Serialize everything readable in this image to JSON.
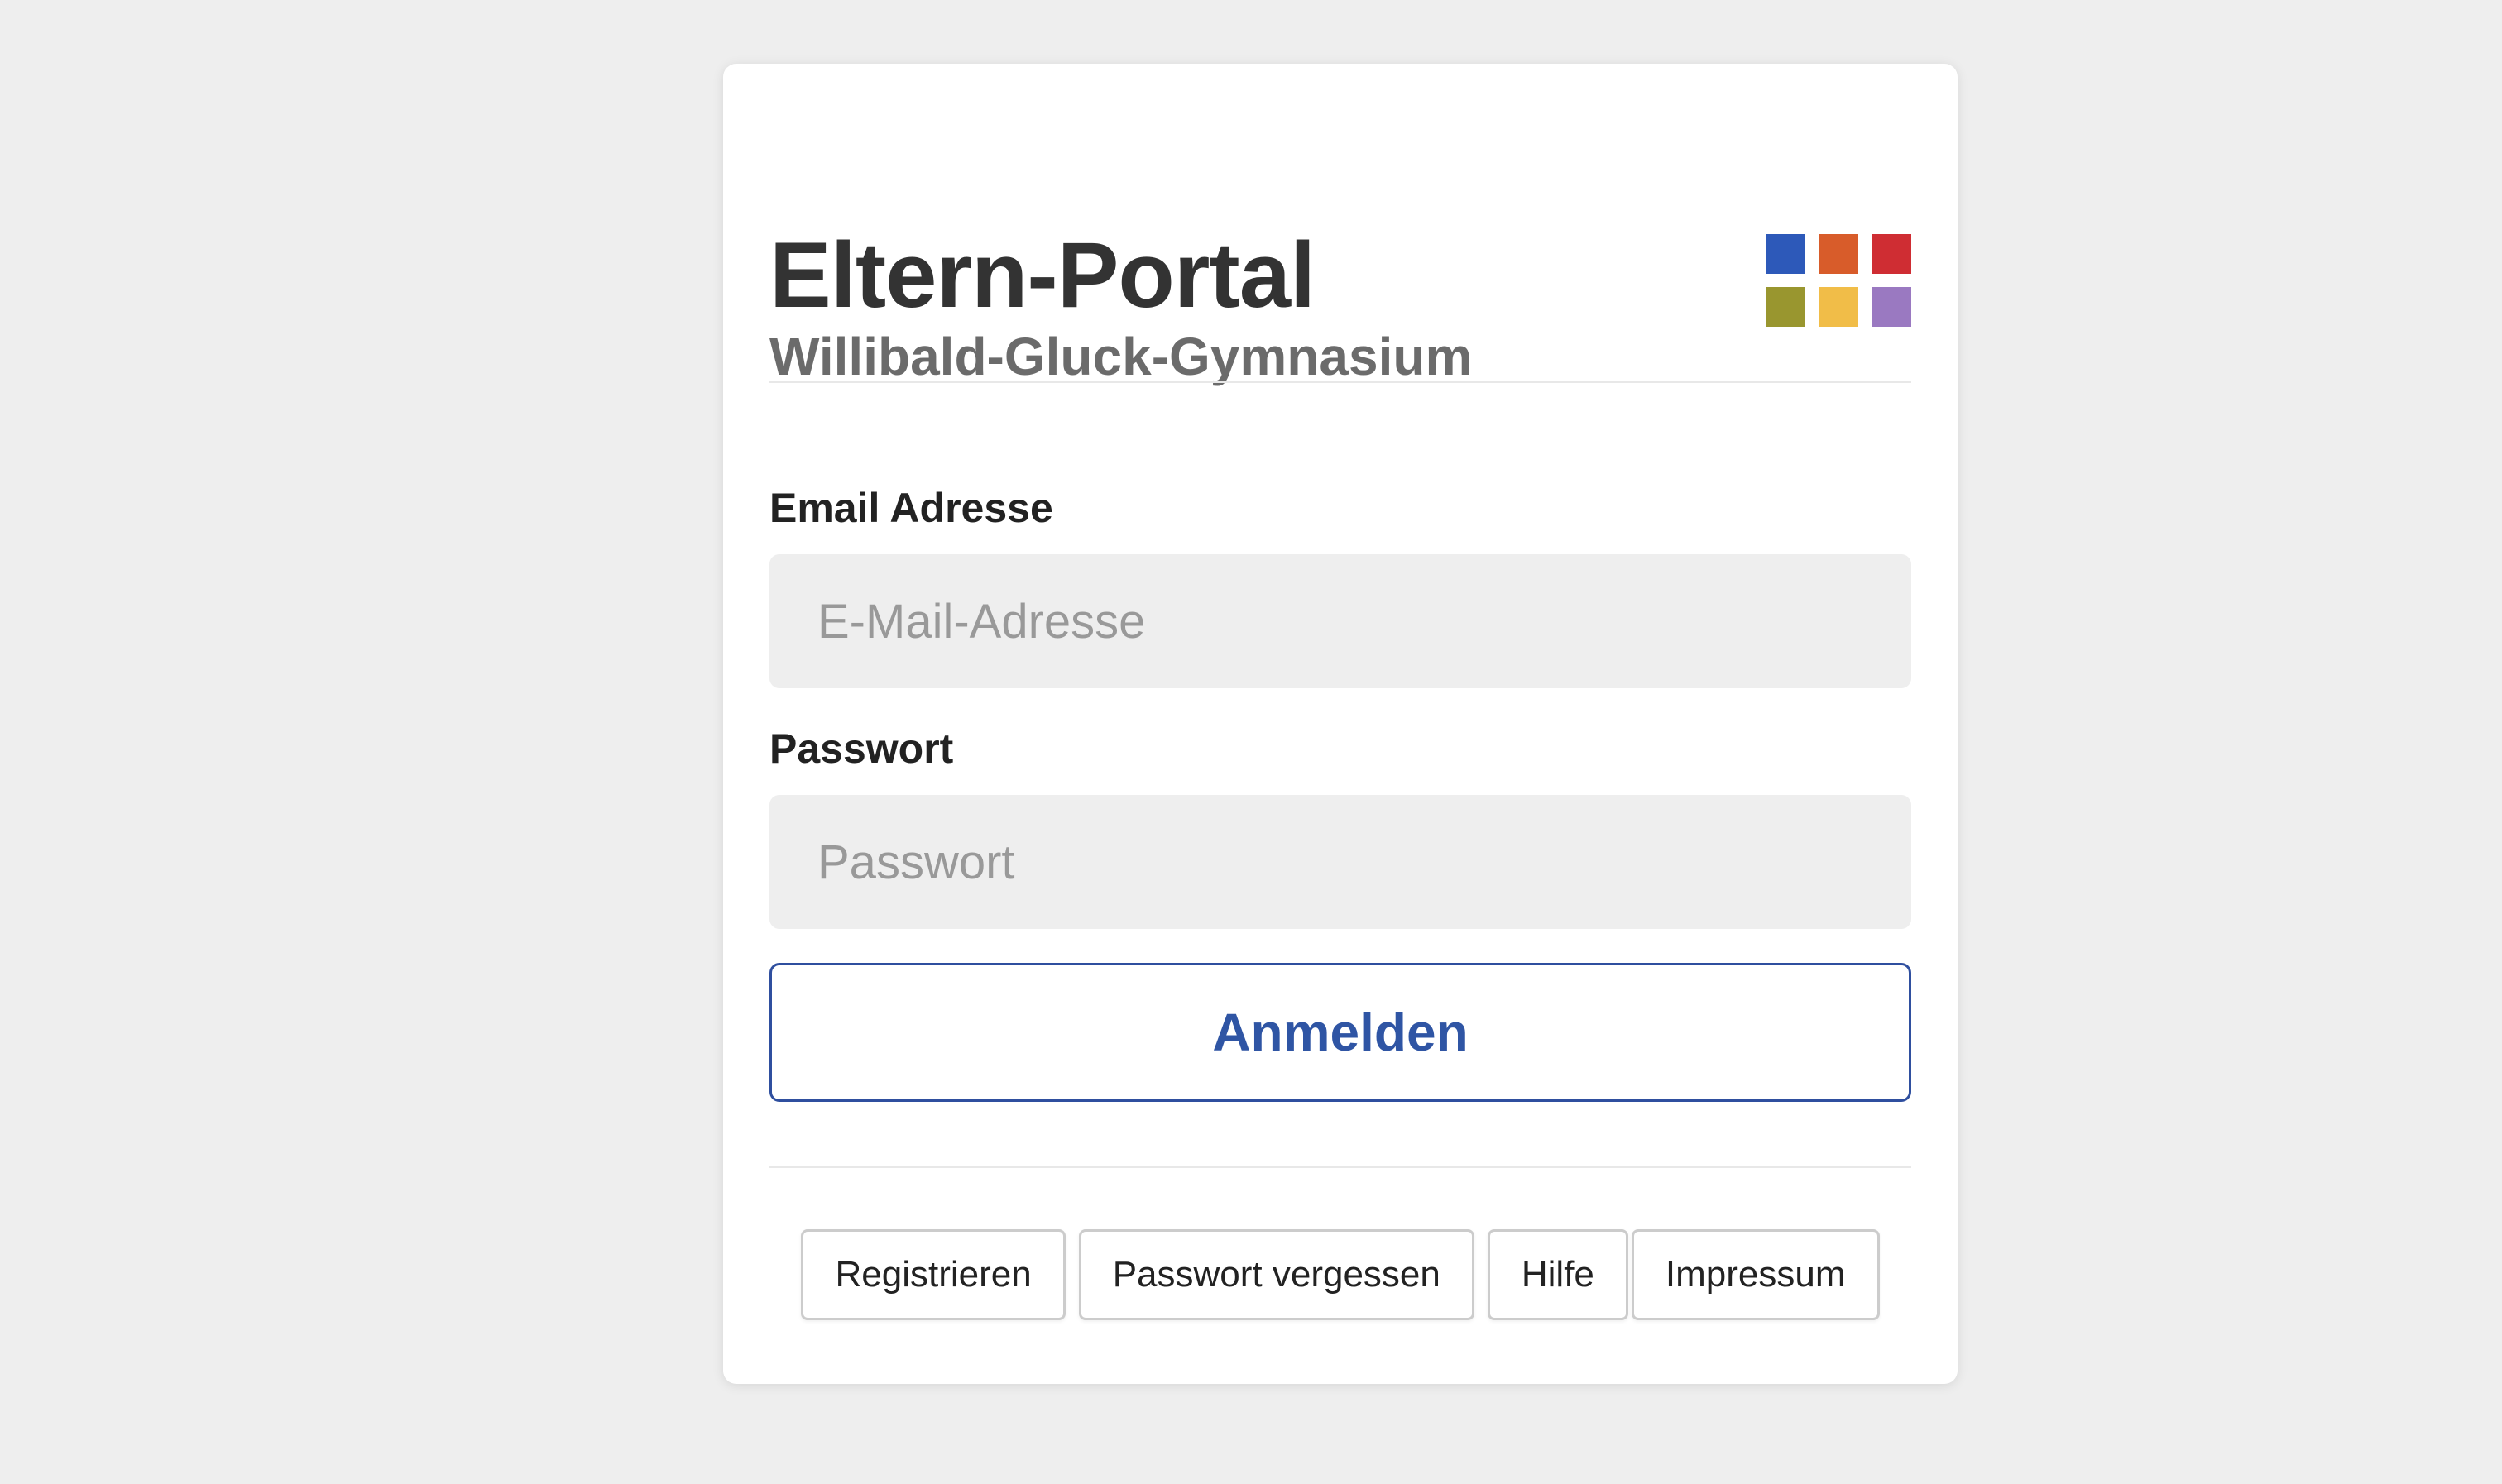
{
  "header": {
    "title": "Eltern-Portal",
    "subtitle": "Willibald-Gluck-Gymnasium"
  },
  "logo": {
    "colors": [
      "#2d59b9",
      "#d85c2a",
      "#cf2d33",
      "#99962f",
      "#f1bd48",
      "#9a79c1"
    ]
  },
  "form": {
    "email_label": "Email Adresse",
    "email_placeholder": "E-Mail-Adresse",
    "email_value": "",
    "password_label": "Passwort",
    "password_placeholder": "Passwort",
    "password_value": "",
    "submit_label": "Anmelden"
  },
  "footer_links": [
    {
      "label": "Registrieren"
    },
    {
      "label": "Passwort vergessen"
    },
    {
      "label": "Hilfe"
    },
    {
      "label": "Impressum"
    }
  ],
  "colors": {
    "accent": "#2f55a4",
    "background": "#eeeeee",
    "card": "#ffffff"
  }
}
